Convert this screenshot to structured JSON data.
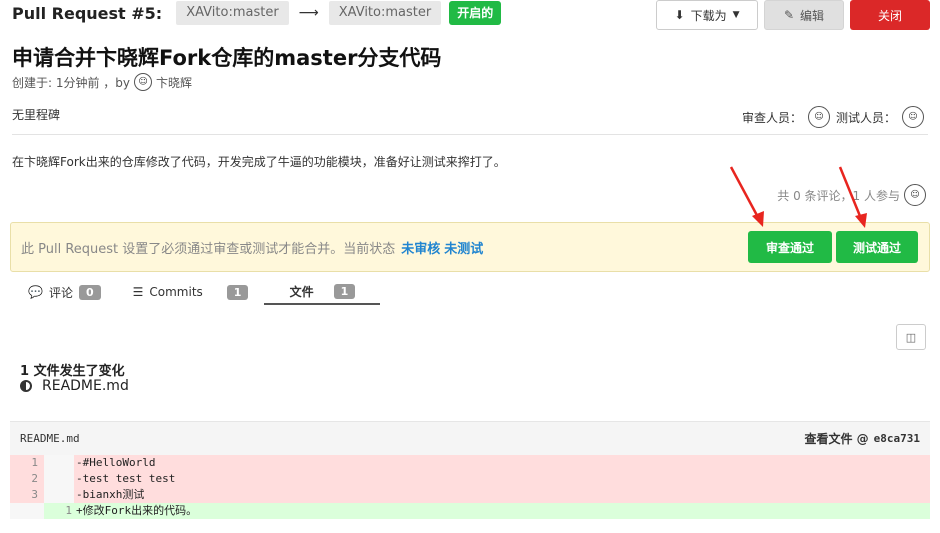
{
  "header": {
    "pr_number": "Pull Request #5:",
    "source_branch": "XAVito:master",
    "arrow": "⟶",
    "target_branch": "XAVito:master",
    "status_badge": "开启的"
  },
  "actions": {
    "download_label": "下载为",
    "edit_label": "编辑",
    "close_label": "关闭"
  },
  "pr": {
    "title": "申请合并卞晓辉Fork仓库的master分支代码",
    "created_label": "创建于: 1分钟前 ，by",
    "author": "卞晓辉",
    "milestone": "无里程碑",
    "reviewer_label": "审查人员：",
    "tester_label": "测试人员：",
    "description": "在卞晓辉Fork出来的仓库修改了代码，开发完成了牛逼的功能模块，准备好让测试来搾打了。",
    "stats": "共 0 条评论，1 人参与"
  },
  "notice": {
    "text": "此 Pull Request 设置了必须通过审查或测试才能合并。当前状态",
    "status_review": "未审核",
    "status_test": "未测试",
    "review_button": "审查通过",
    "test_button": "测试通过"
  },
  "tabs": [
    {
      "label": "评论",
      "count": "0"
    },
    {
      "label": "Commits",
      "count": "1"
    },
    {
      "label": "文件",
      "count": "1"
    }
  ],
  "files": {
    "changed_summary": "1 文件发生了变化",
    "file_name": "README.md"
  },
  "diff": {
    "file_name": "README.md",
    "view_file_label": "查看文件 @",
    "sha": "e8ca731",
    "lines": [
      {
        "old": "1",
        "new": "",
        "text": "-#HelloWorld"
      },
      {
        "old": "2",
        "new": "",
        "text": "-test test test"
      },
      {
        "old": "3",
        "new": "",
        "text": "-bianxh测试"
      },
      {
        "old": "",
        "new": "1",
        "text": "+修改Fork出来的代码。"
      }
    ]
  },
  "colors": {
    "green": "#21ba45",
    "red": "#db2828",
    "blue": "#2185d0",
    "annotation_arrow": "#e8251f"
  }
}
